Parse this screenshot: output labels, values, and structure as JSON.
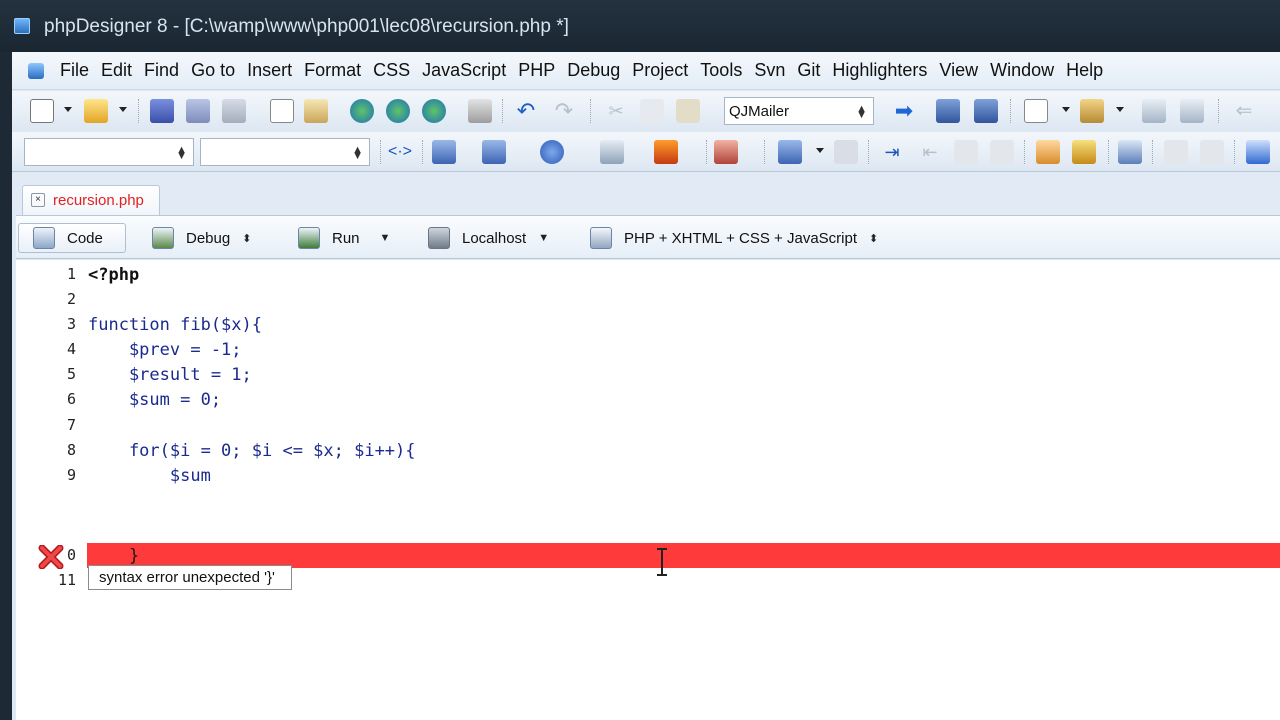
{
  "window": {
    "title": "phpDesigner 8 - [C:\\wamp\\www\\php001\\lec08\\recursion.php *]"
  },
  "menu": [
    "File",
    "Edit",
    "Find",
    "Go to",
    "Insert",
    "Format",
    "CSS",
    "JavaScript",
    "PHP",
    "Debug",
    "Project",
    "Tools",
    "Svn",
    "Git",
    "Highlighters",
    "View",
    "Window",
    "Help"
  ],
  "toolbar": {
    "snippet_combo": "QJMailer"
  },
  "tab": {
    "label": "recursion.php",
    "close": "×"
  },
  "modes": {
    "code": "Code",
    "debug": "Debug",
    "run": "Run",
    "localhost": "Localhost",
    "highlighter": "PHP + XHTML + CSS + JavaScript"
  },
  "editor": {
    "lines": [
      {
        "num": "1",
        "code": "<?php"
      },
      {
        "num": "2",
        "code": ""
      },
      {
        "num": "3",
        "code": "function fib($x){"
      },
      {
        "num": "4",
        "code": "    $prev = -1;"
      },
      {
        "num": "5",
        "code": "    $result = 1;"
      },
      {
        "num": "6",
        "code": "    $sum = 0;"
      },
      {
        "num": "7",
        "code": ""
      },
      {
        "num": "8",
        "code": "    for($i = 0; $i <= $x; $i++){"
      },
      {
        "num": "9",
        "code": "        $sum"
      },
      {
        "num": "0",
        "code": "    }"
      },
      {
        "num": "11",
        "code": ""
      }
    ],
    "error_tooltip": "syntax error unexpected '}'",
    "colors": {
      "error_highlight": "#ff3a3a",
      "code_text": "#1a2a8f"
    }
  }
}
